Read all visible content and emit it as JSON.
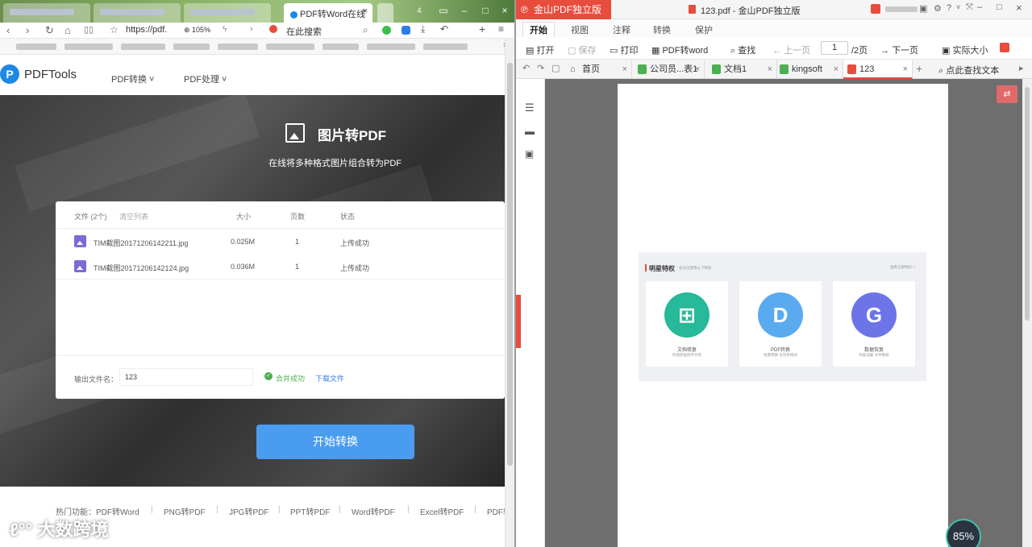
{
  "browser": {
    "tabs": [
      {
        "label": "PDF转Word在线"
      }
    ],
    "tab_count": "4",
    "address": "https://pdf.",
    "zoom": "105%",
    "search_label": "在此搜索"
  },
  "site": {
    "brand": "PDFTools",
    "nav": [
      {
        "label": "PDF转换"
      },
      {
        "label": "PDF处理"
      }
    ],
    "hero_title": "图片转PDF",
    "hero_subtitle": "在线将多种格式图片组合转为PDF",
    "table": {
      "col_files": "文件 (2个)",
      "clear": "清空列表",
      "col_size": "大小",
      "col_pages": "页数",
      "col_status": "状态",
      "rows": [
        {
          "name": "TIM截图20171206142211.jpg",
          "size": "0.025M",
          "pages": "1",
          "status": "上传成功"
        },
        {
          "name": "TIM截图20171206142124.jpg",
          "size": "0.036M",
          "pages": "1",
          "status": "上传成功"
        }
      ]
    },
    "output_label": "输出文件名：",
    "output_value": "123",
    "merge_status": "合并成功",
    "download": "下载文件",
    "start_button": "开始转换",
    "footer": {
      "hot": "热门功能：PDF转Word",
      "links": [
        "PNG转PDF",
        "JPG转PDF",
        "PPT转PDF",
        "Word转PDF",
        "Excel转PDF",
        "PDF转"
      ]
    },
    "watermark": "大数跨境"
  },
  "pdf": {
    "app_name": "金山PDF独立版",
    "window_title": "123.pdf - 金山PDF独立版",
    "menu": [
      {
        "label": "开始"
      },
      {
        "label": "视图"
      },
      {
        "label": "注释"
      },
      {
        "label": "转换"
      },
      {
        "label": "保护"
      }
    ],
    "toolbar": {
      "open": "打开",
      "save": "保存",
      "print": "打印",
      "to_word": "PDF转word",
      "find": "查找",
      "prev": "上一页",
      "page": "1",
      "total": "/2页",
      "next": "下一页",
      "actual": "实际大小"
    },
    "doc_tabs": [
      {
        "label": "首页"
      },
      {
        "label": "公司员...表1"
      },
      {
        "label": "文档1"
      },
      {
        "label": "kingsoft"
      },
      {
        "label": "123"
      }
    ],
    "find_text": "点此查找文本",
    "page_content": {
      "title": "明星特权",
      "subtitle": "会员可使用以下特权",
      "more": "查看全部特权 >",
      "features": [
        {
          "label": "文档修复",
          "sub": "快速修复损坏文档",
          "color": "#26b99a"
        },
        {
          "label": "PDF转换",
          "sub": "批量转换 支持多格式",
          "color": "#5aaaf0"
        },
        {
          "label": "数据恢复",
          "sub": "恢复误删 文件数据",
          "color": "#6c74e8"
        }
      ]
    },
    "gauge": "85%"
  }
}
